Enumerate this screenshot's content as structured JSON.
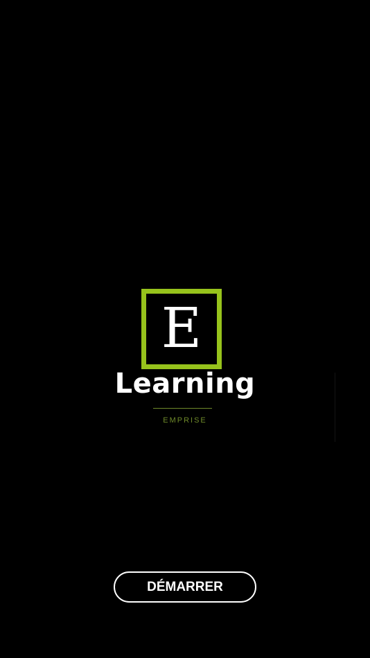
{
  "logo": {
    "letter": "E",
    "word": "Learning",
    "subtitle": "EMPRISE",
    "accent_color": "#97c31c",
    "subtitle_color": "#6f8a2a"
  },
  "actions": {
    "start_label": "DÉMARRER"
  },
  "theme": {
    "background": "#000000",
    "text": "#ffffff"
  }
}
